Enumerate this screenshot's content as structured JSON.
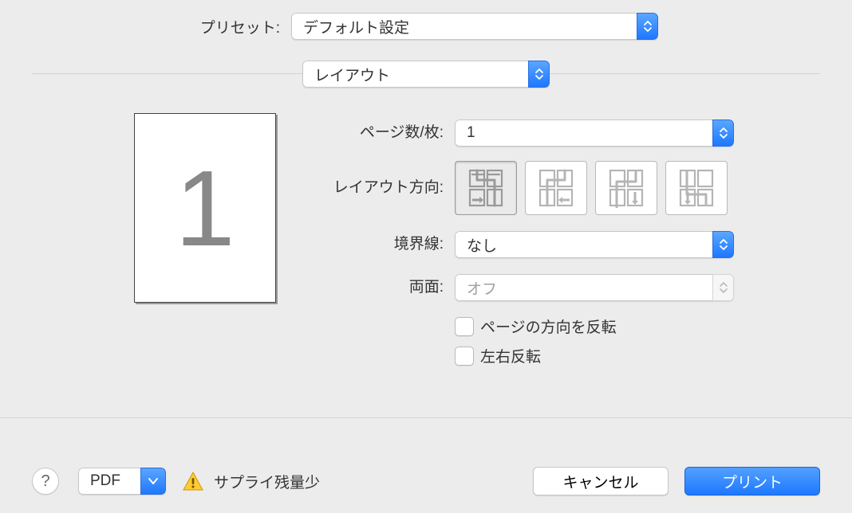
{
  "preset": {
    "label": "プリセット:",
    "value": "デフォルト設定"
  },
  "category": {
    "value": "レイアウト"
  },
  "pages_per_sheet": {
    "label": "ページ数/枚:",
    "value": "1"
  },
  "layout_direction": {
    "label": "レイアウト方向:"
  },
  "border": {
    "label": "境界線:",
    "value": "なし"
  },
  "duplex": {
    "label": "両面:",
    "value": "オフ"
  },
  "reverse_orientation": {
    "label": "ページの方向を反転"
  },
  "flip_horizontal": {
    "label": "左右反転"
  },
  "preview_page": "1",
  "footer": {
    "pdf": "PDF",
    "supply_warning": "サプライ残量少",
    "help": "?",
    "cancel": "キャンセル",
    "print": "プリント"
  }
}
